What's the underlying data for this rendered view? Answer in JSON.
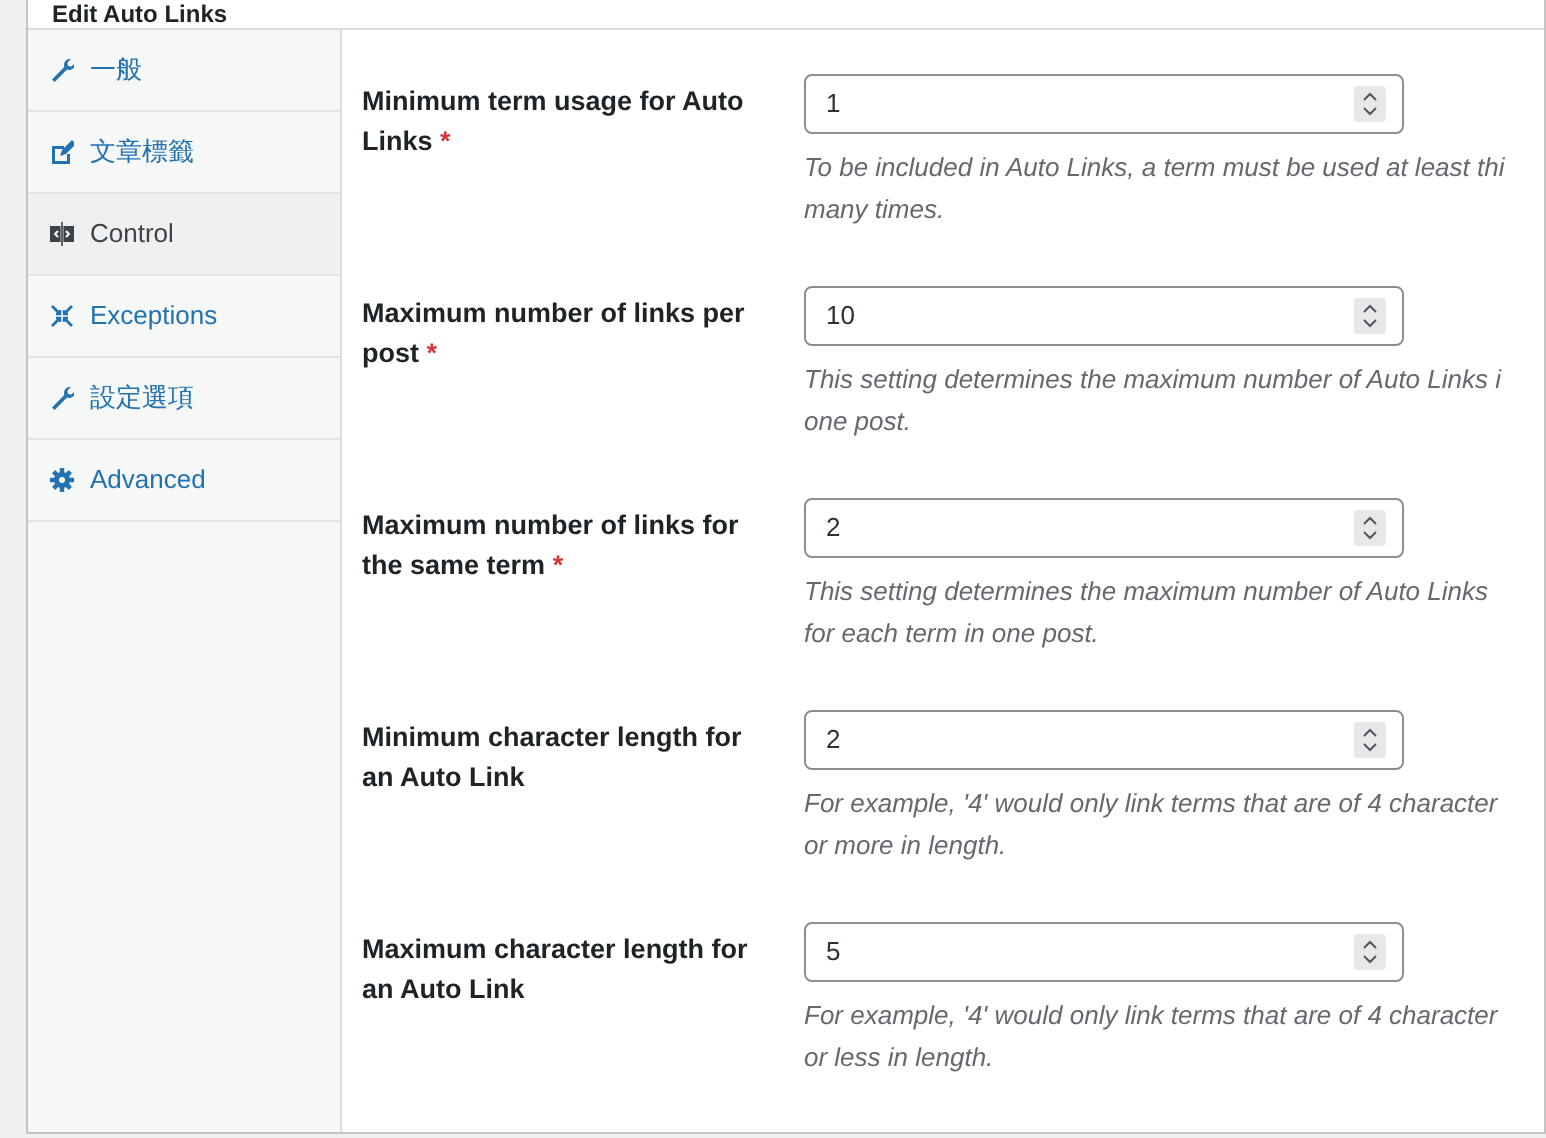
{
  "window": {
    "title": "Edit Auto Links"
  },
  "tabs": [
    {
      "label": "一般",
      "selected": false
    },
    {
      "label": "文章標籤",
      "selected": false
    },
    {
      "label": "Control",
      "selected": true
    },
    {
      "label": "Exceptions",
      "selected": false
    },
    {
      "label": "設定選項",
      "selected": false
    },
    {
      "label": "Advanced",
      "selected": false
    }
  ],
  "fields": [
    {
      "label": "Minimum term usage for Auto Links",
      "required_mark": "*",
      "value": "1",
      "description": [
        "To be included in Auto Links, a term must be used at least thi",
        "many times."
      ]
    },
    {
      "label": "Maximum number of links per post",
      "required_mark": "*",
      "value": "10",
      "description": [
        "This setting determines the maximum number of Auto Links i",
        "one post."
      ]
    },
    {
      "label": "Maximum number of links for the same term",
      "required_mark": "*",
      "value": "2",
      "description": [
        "This setting determines the maximum number of Auto Links",
        "for each term in one post."
      ]
    },
    {
      "label": "Minimum character length for an Auto Link",
      "value": "2",
      "description": [
        "For example, '4' would only link terms that are of 4 character",
        "or more in length."
      ]
    },
    {
      "label": "Maximum character length for an Auto Link",
      "value": "5",
      "description": [
        "For example, '4' would only link terms that are of 4 character",
        "or less in length."
      ]
    }
  ]
}
